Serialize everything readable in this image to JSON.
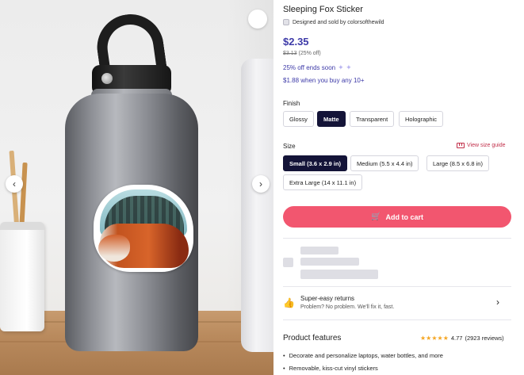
{
  "product": {
    "title": "Sleeping Fox Sticker",
    "seller_text": "Designed and sold by colorsofthewild",
    "price": "$2.35",
    "old_price": "$3.13",
    "discount_text": "(25% off)",
    "sale_text": "25% off ends soon",
    "bulk_text": "$1.88 when you buy any 10+"
  },
  "finish": {
    "label": "Finish",
    "options": [
      "Glossy",
      "Matte",
      "Transparent",
      "Holographic"
    ],
    "selected": "Matte"
  },
  "size": {
    "label": "Size",
    "guide_label": "View size guide",
    "options": [
      "Small (3.6 x 2.9 in)",
      "Medium (5.5 x 4.4 in)",
      "Large (8.5 x 6.8 in)",
      "Extra Large (14 x 11.1 in)"
    ],
    "selected": "Small (3.6 x 2.9 in)"
  },
  "cart": {
    "label": "Add to cart"
  },
  "returns": {
    "title": "Super-easy returns",
    "subtitle": "Problem? No problem. We'll fix it, fast."
  },
  "features": {
    "title": "Product features",
    "rating_value": "4.77",
    "rating_count": "(2923 reviews)",
    "bullets": [
      "Decorate and personalize laptops, water bottles, and more",
      "Removable, kiss-cut vinyl stickers"
    ]
  },
  "icons": {
    "favorite": "heart-icon",
    "prev": "chevron-left-icon",
    "next": "chevron-right-icon",
    "seller": "tag-icon",
    "sale": "sparkle-icon",
    "size_guide": "ruler-icon",
    "cart": "cart-icon",
    "returns": "thumbs-up-icon",
    "returns_more": "chevron-right-icon",
    "stars": "star-icon"
  },
  "colors": {
    "accent": "#3d3aa8",
    "selected_option": "#141438",
    "cart_button": "#f2566f",
    "size_guide": "#c2304b",
    "star": "#f5a623"
  },
  "rating_stars": 4.77
}
